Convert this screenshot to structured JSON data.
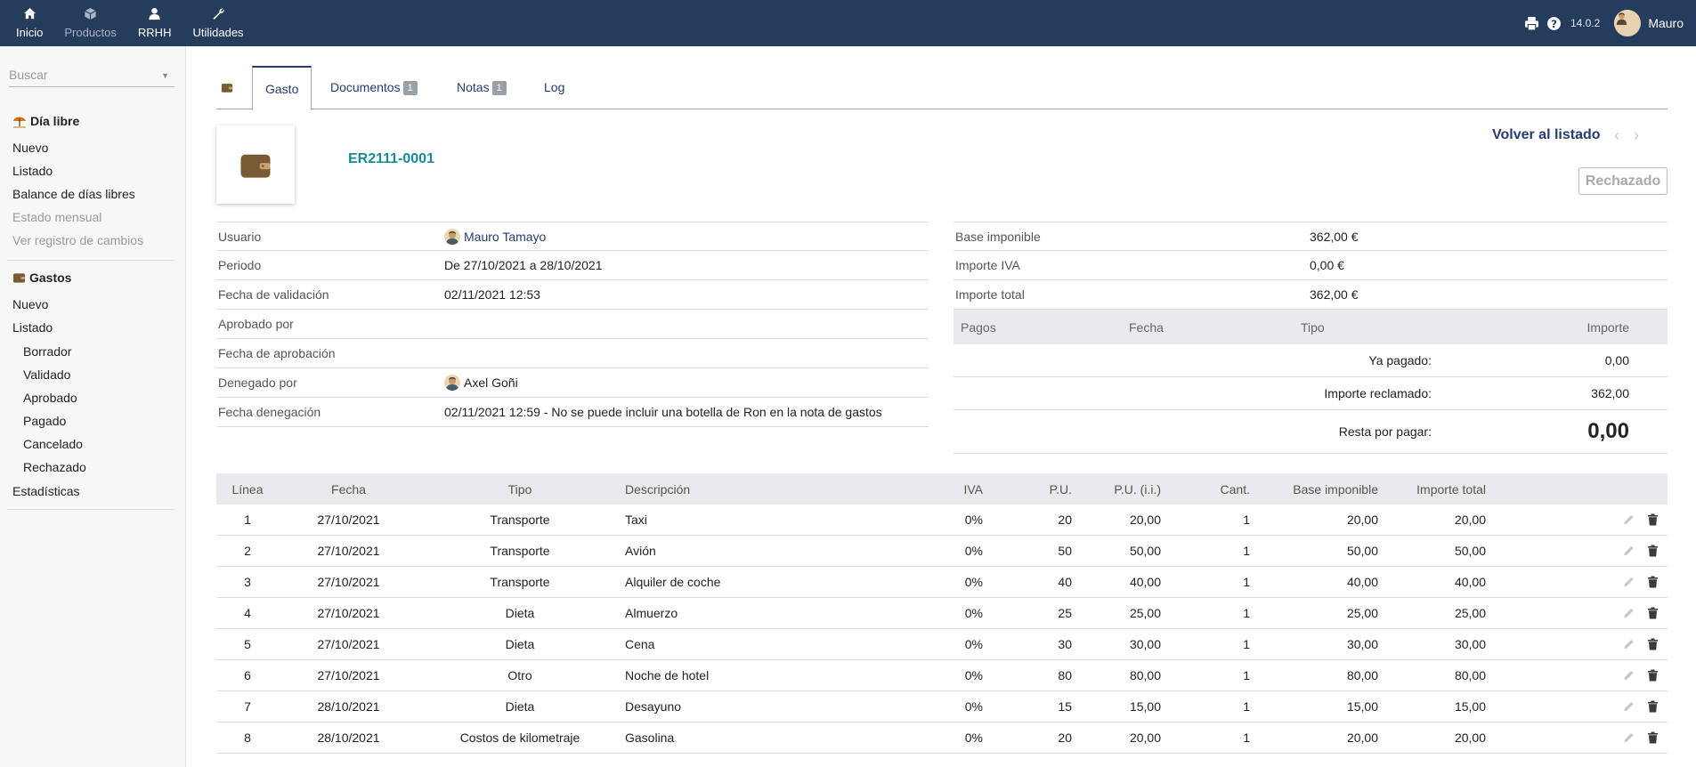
{
  "topnav": [
    {
      "label": "Inicio",
      "icon": "home-icon",
      "dim": false
    },
    {
      "label": "Productos",
      "icon": "cube-icon",
      "dim": true
    },
    {
      "label": "RRHH",
      "icon": "user-icon",
      "dim": false
    },
    {
      "label": "Utilidades",
      "icon": "wrench-icon",
      "dim": false
    }
  ],
  "topright": {
    "version": "14.0.2",
    "user": "Mauro"
  },
  "sidebar": {
    "search_placeholder": "Buscar",
    "section1": "Día libre",
    "section1_items": [
      "Nuevo",
      "Listado",
      "Balance de días libres",
      "Estado mensual",
      "Ver registro de cambios"
    ],
    "section2": "Gastos",
    "section2_items": [
      "Nuevo",
      "Listado"
    ],
    "section2_sub": [
      "Borrador",
      "Validado",
      "Aprobado",
      "Pagado",
      "Cancelado",
      "Rechazado"
    ],
    "stats": "Estadísticas"
  },
  "tabs": {
    "gasto": "Gasto",
    "documentos": "Documentos",
    "documentos_count": "1",
    "notas": "Notas",
    "notas_count": "1",
    "log": "Log"
  },
  "header": {
    "ref": "ER2111-0001",
    "back": "Volver al listado",
    "status": "Rechazado"
  },
  "info_left": [
    {
      "label": "Usuario",
      "value": "Mauro Tamayo",
      "user": true,
      "link": true
    },
    {
      "label": "Periodo",
      "value": "De 27/10/2021 a 28/10/2021"
    },
    {
      "label": "Fecha de validación",
      "value": "02/11/2021 12:53"
    },
    {
      "label": "Aprobado por",
      "value": ""
    },
    {
      "label": "Fecha de aprobación",
      "value": ""
    },
    {
      "label": "Denegado por",
      "value": "Axel Goñi",
      "user": true
    },
    {
      "label": "Fecha denegación",
      "value": "02/11/2021 12:59 - No se puede incluir una botella de Ron en la nota de gastos"
    }
  ],
  "info_right": [
    {
      "label": "Base imponible",
      "value": "362,00 €"
    },
    {
      "label": "Importe IVA",
      "value": "0,00 €"
    },
    {
      "label": "Importe total",
      "value": "362,00 €"
    }
  ],
  "payments": {
    "headers": [
      "Pagos",
      "Fecha",
      "Tipo",
      "Importe"
    ],
    "paid_label": "Ya pagado:",
    "paid_value": "0,00",
    "claimed_label": "Importe reclamado:",
    "claimed_value": "362,00",
    "remain_label": "Resta por pagar:",
    "remain_value": "0,00"
  },
  "lines": {
    "headers": [
      "Línea",
      "Fecha",
      "Tipo",
      "Descripción",
      "IVA",
      "P.U.",
      "P.U. (i.i.)",
      "Cant.",
      "Base imponible",
      "Importe total"
    ],
    "rows": [
      [
        "1",
        "27/10/2021",
        "Transporte",
        "Taxi",
        "0%",
        "20",
        "20,00",
        "1",
        "20,00",
        "20,00"
      ],
      [
        "2",
        "27/10/2021",
        "Transporte",
        "Avión",
        "0%",
        "50",
        "50,00",
        "1",
        "50,00",
        "50,00"
      ],
      [
        "3",
        "27/10/2021",
        "Transporte",
        "Alquiler de coche",
        "0%",
        "40",
        "40,00",
        "1",
        "40,00",
        "40,00"
      ],
      [
        "4",
        "27/10/2021",
        "Dieta",
        "Almuerzo",
        "0%",
        "25",
        "25,00",
        "1",
        "25,00",
        "25,00"
      ],
      [
        "5",
        "27/10/2021",
        "Dieta",
        "Cena",
        "0%",
        "30",
        "30,00",
        "1",
        "30,00",
        "30,00"
      ],
      [
        "6",
        "27/10/2021",
        "Otro",
        "Noche de hotel",
        "0%",
        "80",
        "80,00",
        "1",
        "80,00",
        "80,00"
      ],
      [
        "7",
        "28/10/2021",
        "Dieta",
        "Desayuno",
        "0%",
        "15",
        "15,00",
        "1",
        "15,00",
        "15,00"
      ],
      [
        "8",
        "28/10/2021",
        "Costos de kilometraje",
        "Gasolina",
        "0%",
        "20",
        "20,00",
        "1",
        "20,00",
        "20,00"
      ]
    ]
  }
}
